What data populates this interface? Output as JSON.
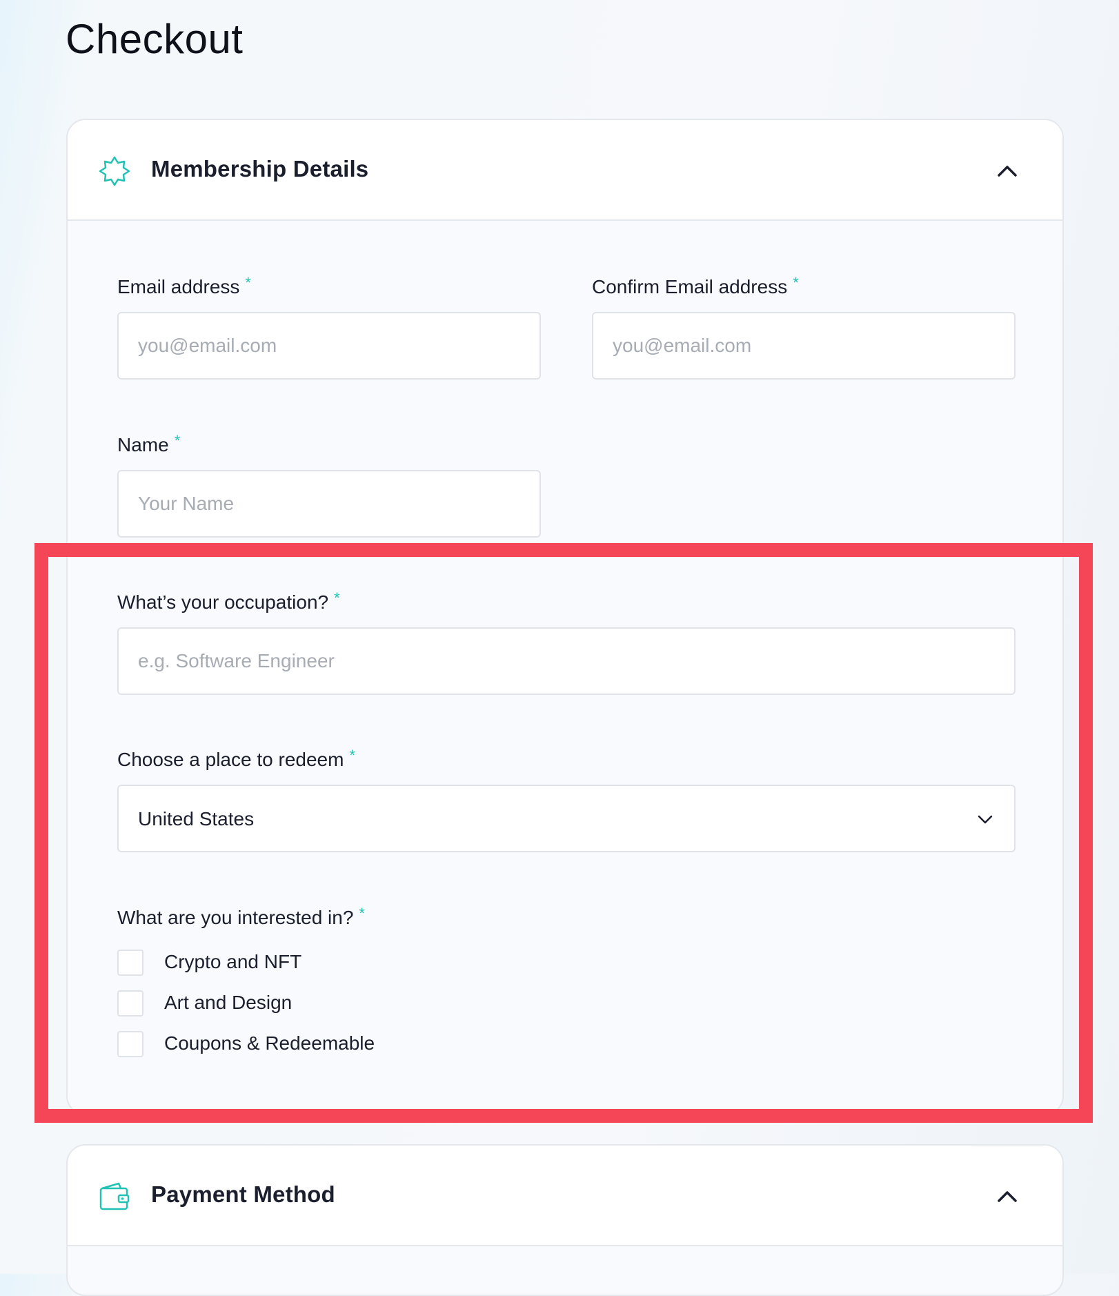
{
  "page": {
    "title": "Checkout"
  },
  "membership": {
    "title": "Membership Details",
    "icon": "star-badge-icon",
    "email": {
      "label": "Email address",
      "required": "*",
      "placeholder": "you@email.com",
      "value": ""
    },
    "confirm_email": {
      "label": "Confirm Email address",
      "required": "*",
      "placeholder": "you@email.com",
      "value": ""
    },
    "name": {
      "label": "Name",
      "required": "*",
      "placeholder": "Your Name",
      "value": ""
    },
    "occupation": {
      "label": "What’s your occupation?",
      "required": "*",
      "placeholder": "e.g. Software Engineer",
      "value": ""
    },
    "redeem": {
      "label": "Choose a place to redeem",
      "required": "*",
      "selected": "United States"
    },
    "interests": {
      "label": "What are you interested in?",
      "required": "*",
      "options": [
        {
          "label": "Crypto and NFT",
          "checked": false
        },
        {
          "label": "Art and Design",
          "checked": false
        },
        {
          "label": "Coupons & Redeemable",
          "checked": false
        }
      ]
    }
  },
  "payment": {
    "title": "Payment Method",
    "icon": "wallet-icon"
  },
  "colors": {
    "accent": "#21c2b3",
    "highlight": "#f44656",
    "border": "#dfe3e8"
  }
}
